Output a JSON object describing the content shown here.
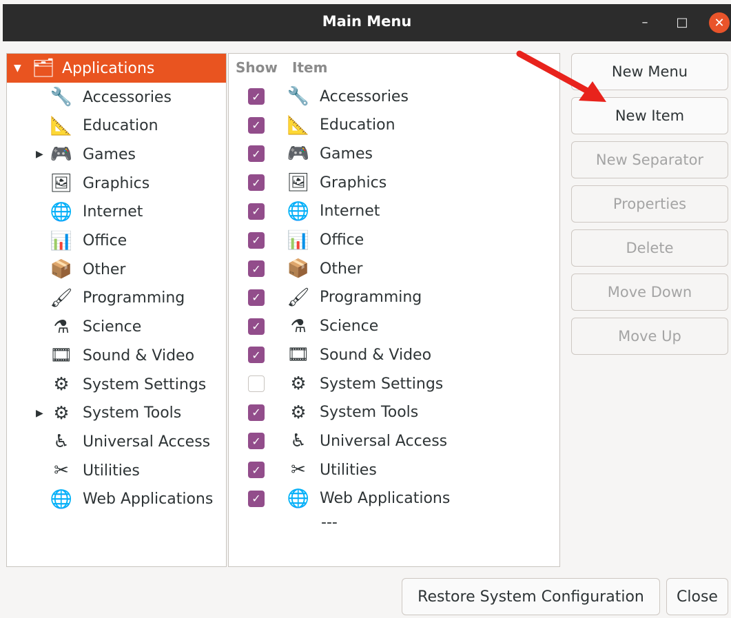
{
  "window": {
    "title": "Main Menu",
    "minimize_symbol": "–",
    "maximize_symbol": "□",
    "close_symbol": "✕"
  },
  "tree": {
    "root_label": "Applications",
    "items": [
      {
        "label": "Accessories",
        "icon": "accessories-icon",
        "glyph": "🔧",
        "expandable": false
      },
      {
        "label": "Education",
        "icon": "education-icon",
        "glyph": "📐",
        "expandable": false
      },
      {
        "label": "Games",
        "icon": "games-icon",
        "glyph": "🎮",
        "expandable": true
      },
      {
        "label": "Graphics",
        "icon": "graphics-icon",
        "glyph": "🖼",
        "expandable": false
      },
      {
        "label": "Internet",
        "icon": "internet-icon",
        "glyph": "🌐",
        "expandable": false
      },
      {
        "label": "Office",
        "icon": "office-icon",
        "glyph": "📊",
        "expandable": false
      },
      {
        "label": "Other",
        "icon": "other-icon",
        "glyph": "📦",
        "expandable": false
      },
      {
        "label": "Programming",
        "icon": "programming-icon",
        "glyph": "🖌",
        "expandable": false
      },
      {
        "label": "Science",
        "icon": "science-icon",
        "glyph": "⚗",
        "expandable": false
      },
      {
        "label": "Sound & Video",
        "icon": "sound-video-icon",
        "glyph": "🎞",
        "expandable": false
      },
      {
        "label": "System Settings",
        "icon": "system-settings-icon",
        "glyph": "⚙",
        "expandable": false
      },
      {
        "label": "System Tools",
        "icon": "system-tools-icon",
        "glyph": "⚙",
        "expandable": true
      },
      {
        "label": "Universal Access",
        "icon": "universal-access-icon",
        "glyph": "♿",
        "expandable": false
      },
      {
        "label": "Utilities",
        "icon": "utilities-icon",
        "glyph": "✂",
        "expandable": false
      },
      {
        "label": "Web Applications",
        "icon": "web-applications-icon",
        "glyph": "🌐",
        "expandable": false
      }
    ]
  },
  "list": {
    "col_show": "Show",
    "col_item": "Item",
    "separator_text": "---",
    "items": [
      {
        "label": "Accessories",
        "show": true
      },
      {
        "label": "Education",
        "show": true
      },
      {
        "label": "Games",
        "show": true
      },
      {
        "label": "Graphics",
        "show": true
      },
      {
        "label": "Internet",
        "show": true
      },
      {
        "label": "Office",
        "show": true
      },
      {
        "label": "Other",
        "show": true
      },
      {
        "label": "Programming",
        "show": true
      },
      {
        "label": "Science",
        "show": true
      },
      {
        "label": "Sound & Video",
        "show": true
      },
      {
        "label": "System Settings",
        "show": false
      },
      {
        "label": "System Tools",
        "show": true
      },
      {
        "label": "Universal Access",
        "show": true
      },
      {
        "label": "Utilities",
        "show": true
      },
      {
        "label": "Web Applications",
        "show": true
      }
    ]
  },
  "actions": {
    "new_menu": "New Menu",
    "new_item": "New Item",
    "new_separator": "New Separator",
    "properties": "Properties",
    "delete": "Delete",
    "move_down": "Move Down",
    "move_up": "Move Up"
  },
  "footer": {
    "restore": "Restore System Configuration",
    "close": "Close"
  },
  "colors": {
    "accent": "#e95420",
    "checkbox": "#924d8b",
    "titlebar": "#2c2c2c",
    "arrow": "#e8231c"
  }
}
